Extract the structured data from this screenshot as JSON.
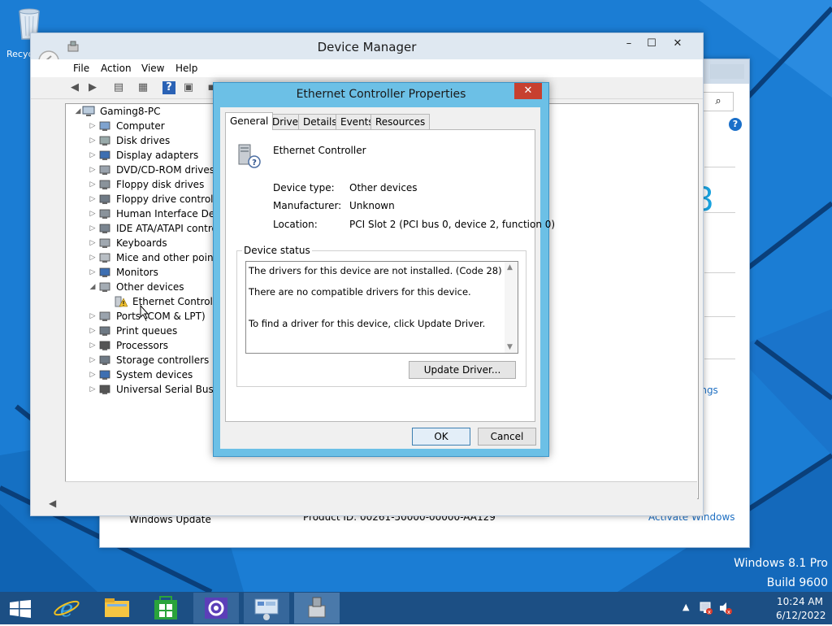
{
  "desktop": {
    "recycle_label": "Recyc",
    "os_name": "Windows 8.1 Pro",
    "build": "Build 9600"
  },
  "system_window": {
    "windows_update": "Windows Update",
    "product_id": "Product ID: 00261-50000-00000-AA129",
    "activate": "Activate Windows",
    "partial_big_text": "8",
    "partial_link": "ings"
  },
  "device_manager": {
    "title": "Device Manager",
    "menu": [
      "File",
      "Action",
      "View",
      "Help"
    ],
    "tree": {
      "root": "Gaming8-PC",
      "items": [
        {
          "label": "Computer",
          "icon": "computer-icon"
        },
        {
          "label": "Disk drives",
          "icon": "disk-drive-icon"
        },
        {
          "label": "Display adapters",
          "icon": "display-adapter-icon"
        },
        {
          "label": "DVD/CD-ROM drives",
          "icon": "dvd-drive-icon"
        },
        {
          "label": "Floppy disk drives",
          "icon": "floppy-drive-icon"
        },
        {
          "label": "Floppy drive controller",
          "icon": "floppy-controller-icon"
        },
        {
          "label": "Human Interface Devic",
          "icon": "hid-icon"
        },
        {
          "label": "IDE ATA/ATAPI contro",
          "icon": "ide-controller-icon"
        },
        {
          "label": "Keyboards",
          "icon": "keyboard-icon"
        },
        {
          "label": "Mice and other pointin",
          "icon": "mouse-icon"
        },
        {
          "label": "Monitors",
          "icon": "monitor-icon"
        },
        {
          "label": "Other devices",
          "icon": "other-devices-icon"
        },
        {
          "label": "Ethernet Controller",
          "icon": "warning-device-icon"
        },
        {
          "label": "Ports (COM & LPT)",
          "icon": "port-icon"
        },
        {
          "label": "Print queues",
          "icon": "printer-icon"
        },
        {
          "label": "Processors",
          "icon": "processor-icon"
        },
        {
          "label": "Storage controllers",
          "icon": "storage-controller-icon"
        },
        {
          "label": "System devices",
          "icon": "system-device-icon"
        },
        {
          "label": "Universal Serial Bus co",
          "icon": "usb-icon"
        }
      ]
    }
  },
  "properties": {
    "title": "Ethernet Controller Properties",
    "tabs": [
      "General",
      "Driver",
      "Details",
      "Events",
      "Resources"
    ],
    "device_name": "Ethernet Controller",
    "fields": [
      {
        "label": "Device type:",
        "value": "Other devices"
      },
      {
        "label": "Manufacturer:",
        "value": "Unknown"
      },
      {
        "label": "Location:",
        "value": "PCI Slot 2 (PCI bus 0, device 2, function 0)"
      }
    ],
    "status_legend": "Device status",
    "status_lines": [
      "The drivers for this device are not installed. (Code 28)",
      "There are no compatible drivers for this device.",
      "To find a driver for this device, click Update Driver."
    ],
    "update_driver": "Update Driver...",
    "ok": "OK",
    "cancel": "Cancel"
  },
  "taskbar": {
    "time": "10:24 AM",
    "date": "6/12/2022",
    "apps": [
      "internet-explorer-icon",
      "file-explorer-icon",
      "store-icon",
      "control-panel-icon",
      "system-icon",
      "device-manager-icon"
    ]
  },
  "colors": {
    "desktop": "#1b7dd4",
    "taskbar": "#1c4f84",
    "dialog_frame": "#6cc0e6",
    "close_red": "#c7402f"
  }
}
